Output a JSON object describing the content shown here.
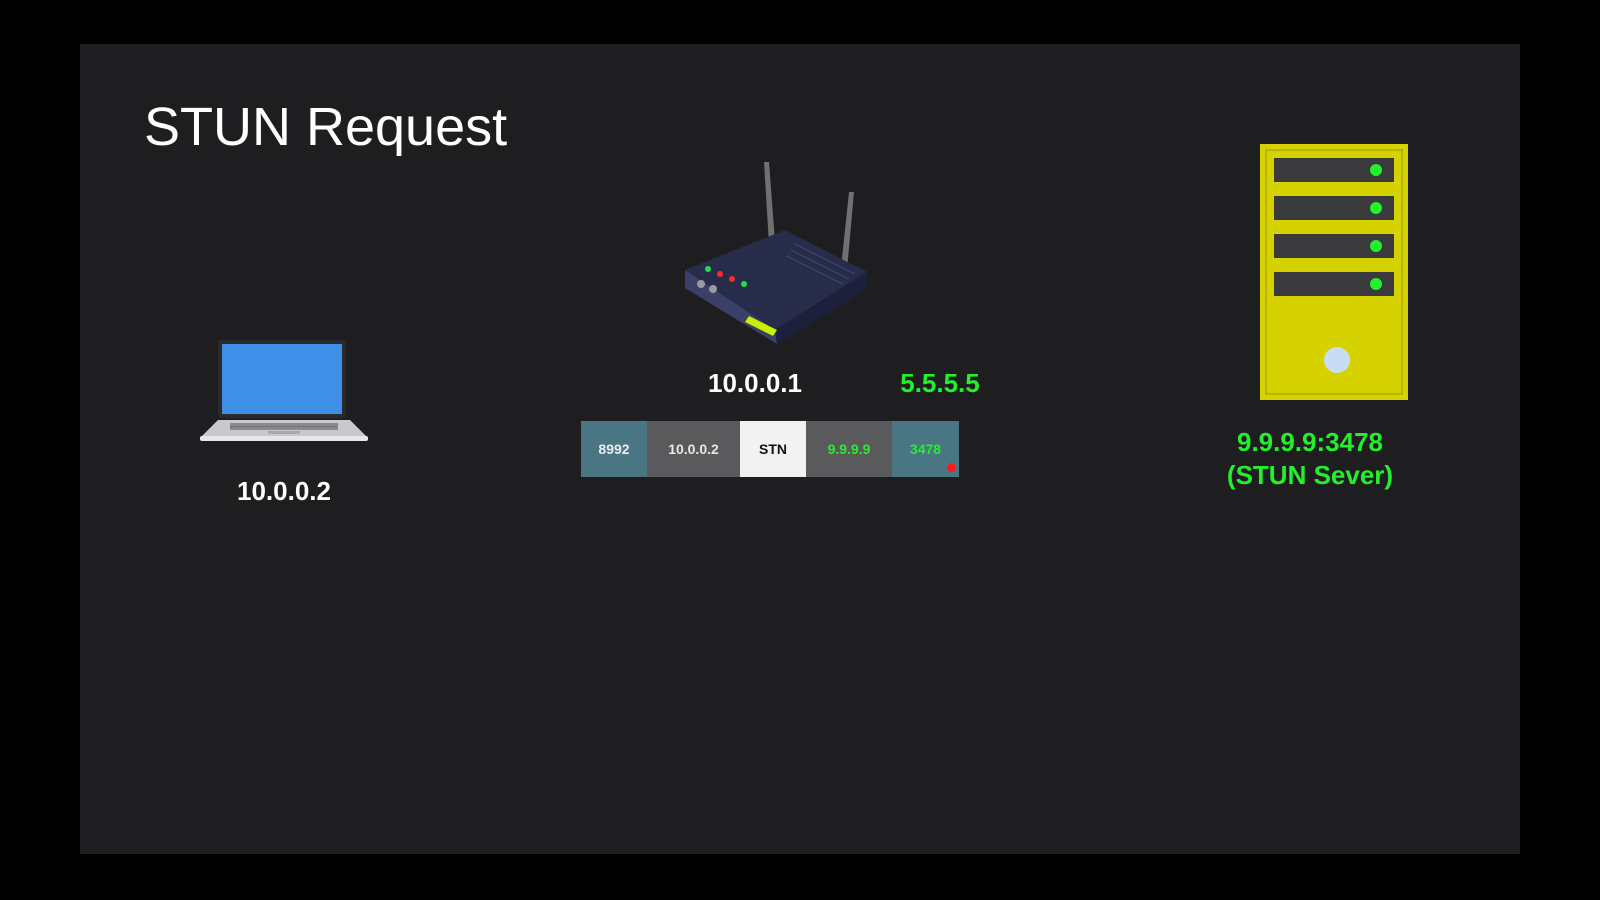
{
  "slide": {
    "title": "STUN Request"
  },
  "laptop": {
    "ip": "10.0.0.2",
    "icon": "laptop-icon"
  },
  "router": {
    "private_ip": "10.0.0.1",
    "public_ip": "5.5.5.5",
    "icon": "router-icon"
  },
  "packet": {
    "src_port": "8992",
    "src_ip": "10.0.0.2",
    "payload": "STN",
    "dst_ip": "9.9.9.9",
    "dst_port": "3478"
  },
  "server": {
    "address": "9.9.9.9:3478",
    "role": "(STUN Sever)",
    "icon": "server-icon"
  },
  "colors": {
    "background": "#1e1d1f",
    "highlight_green": "#22f02a",
    "server_yellow": "#d6d200",
    "port_teal": "#4a7582",
    "ip_gray": "#5a5a5d"
  }
}
